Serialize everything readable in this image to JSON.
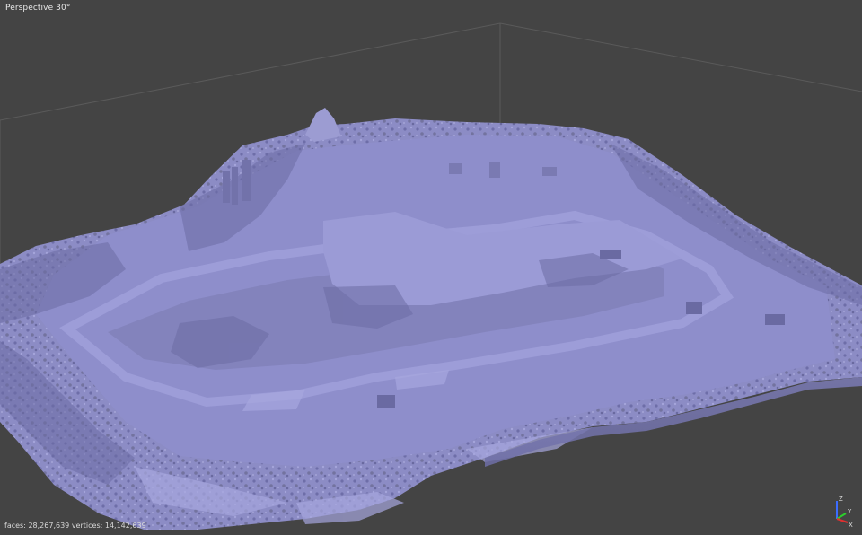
{
  "viewport": {
    "view_label": "Perspective 30°",
    "background_color": "#444444",
    "mesh_color": "#8d8dc6"
  },
  "stats": {
    "faces_label": "faces:",
    "faces_value": "28,267,639",
    "vertices_label": "vertices:",
    "vertices_value": "14,142,639"
  },
  "axis_gizmo": {
    "z_label": "Z",
    "y_label": "Y",
    "x_label": "X"
  }
}
